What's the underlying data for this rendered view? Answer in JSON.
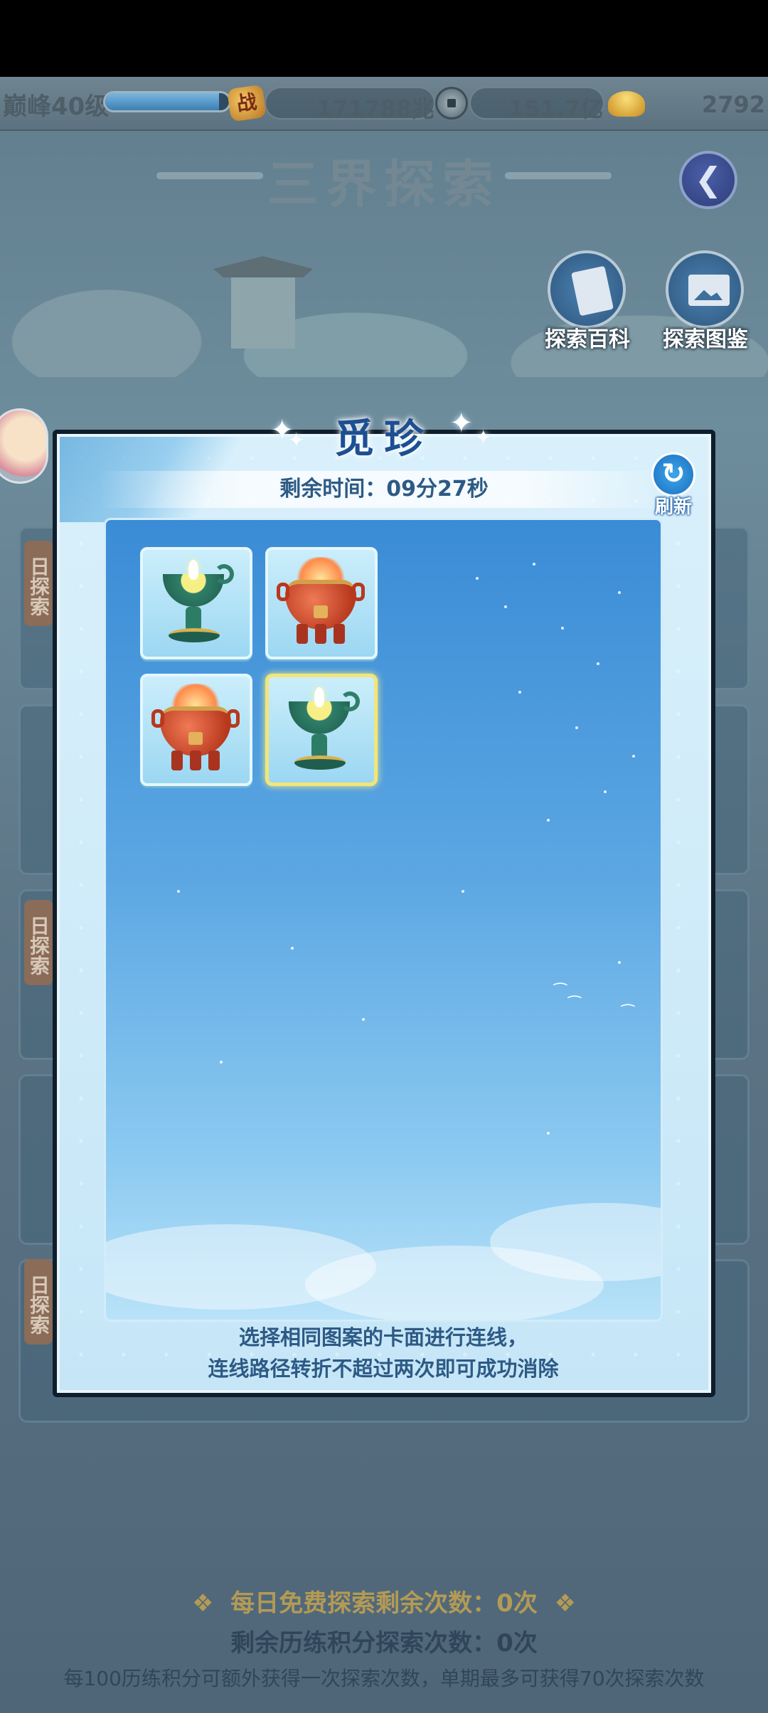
{
  "topbar": {
    "level": "巅峰40级",
    "exp_progress": 0.92,
    "zhan_label": "战",
    "combat_power": "171788兆",
    "coins": "151.7亿",
    "ingots": "2792"
  },
  "header": {
    "title": "三界探索",
    "back_icon": "back-arrow-icon",
    "buttons": [
      {
        "label": "探索百科",
        "icon": "book-icon"
      },
      {
        "label": "探索图鉴",
        "icon": "picture-icon"
      }
    ]
  },
  "background": {
    "tab_label": "日探索"
  },
  "modal": {
    "title": "觅珍",
    "timer": "剩余时间：09分27秒",
    "refresh_label": "刷新",
    "refresh_icon": "refresh-icon",
    "tiles": [
      {
        "icon": "lamp",
        "selected": false
      },
      {
        "icon": "cauldron",
        "selected": false
      },
      {
        "icon": "cauldron",
        "selected": false
      },
      {
        "icon": "lamp",
        "selected": true
      }
    ],
    "hint_line1": "选择相同图案的卡面进行连线，",
    "hint_line2": "连线路径转折不超过两次即可成功消除"
  },
  "footer": {
    "free_remaining": "每日免费探索剩余次数：0次",
    "points_remaining": "剩余历练积分探索次数：0次",
    "note": "每100历练积分可额外获得一次探索次数，单期最多可获得70次探索次数"
  },
  "colors": {
    "accent": "#1d4f92",
    "gold": "#b39a55",
    "selected_border": "#f2e678"
  }
}
